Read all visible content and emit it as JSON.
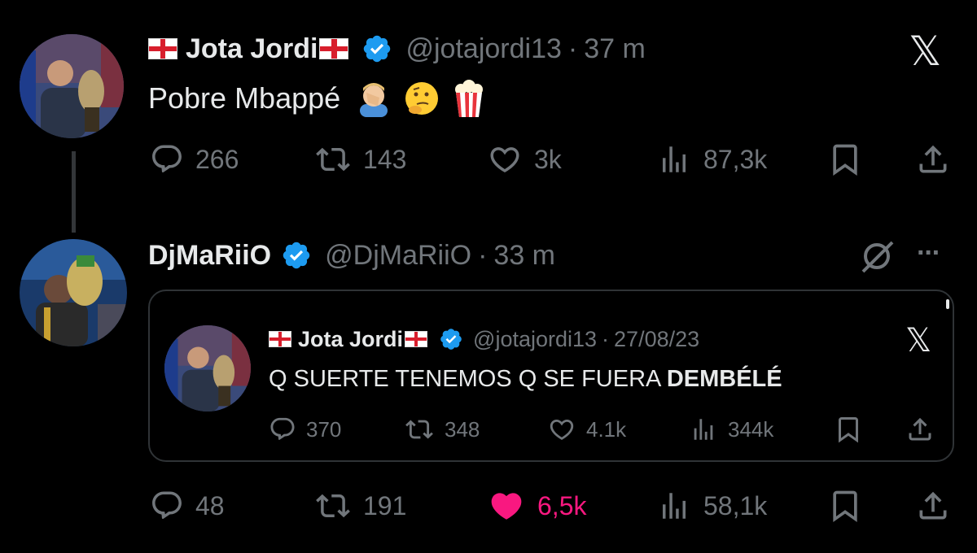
{
  "tweet1": {
    "display_name": "Jota Jordi",
    "handle": "@jotajordi13",
    "separator": "·",
    "time": "37 m",
    "text": "Pobre Mbappé",
    "emojis": [
      "facepalm-emoji",
      "thinking-emoji",
      "popcorn-emoji"
    ],
    "actions": {
      "replies": "266",
      "reposts": "143",
      "likes": "3k",
      "views": "87,3k"
    }
  },
  "tweet2": {
    "display_name": "DjMaRiiO",
    "handle": "@DjMaRiiO",
    "separator": "·",
    "time": "33 m",
    "quoted": {
      "display_name": "Jota Jordi",
      "handle": "@jotajordi13",
      "separator": "·",
      "date": "27/08/23",
      "text_prefix": "Q SUERTE TENEMOS Q SE FUERA ",
      "text_bold": "DEMBÉLÉ",
      "actions": {
        "replies": "370",
        "reposts": "348",
        "likes": "4.1k",
        "views": "344k"
      }
    },
    "actions": {
      "replies": "48",
      "reposts": "191",
      "likes": "6,5k",
      "views": "58,1k"
    }
  },
  "icons": {
    "x_logo": "𝕏",
    "more": "···"
  },
  "colors": {
    "background": "#000000",
    "text": "#e7e9ea",
    "muted": "#71767b",
    "verified": "#1d9bf0",
    "like_active": "#f91880",
    "thread_line": "#333639",
    "quote_border": "#2f3336"
  }
}
